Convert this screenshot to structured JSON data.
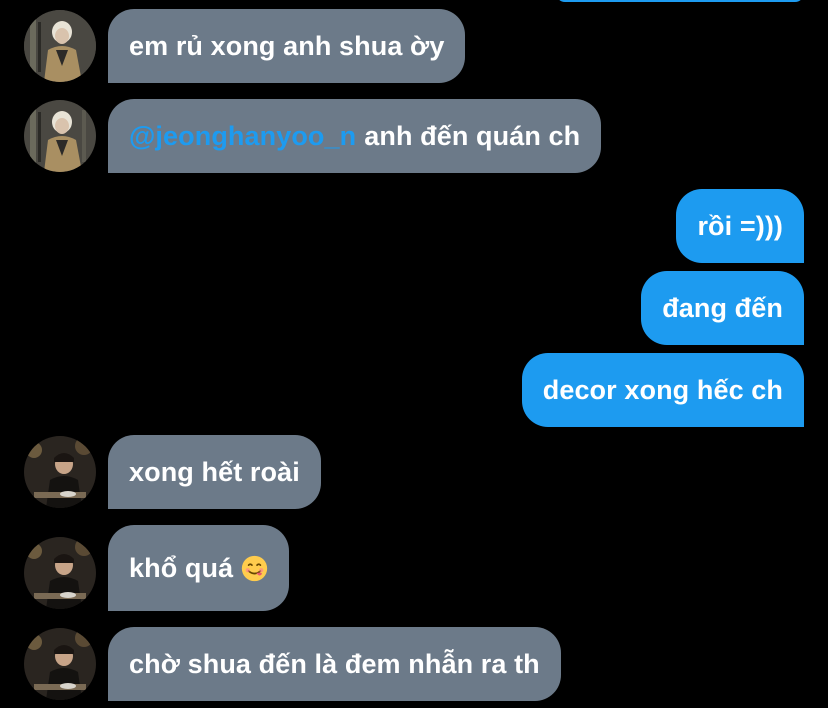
{
  "messages": [
    {
      "sender": "other",
      "avatar": "avatar-blond-man",
      "text": "em rủ xong anh shua ờy"
    },
    {
      "sender": "other",
      "avatar": "avatar-blond-man",
      "mention": "@jeonghanyoo_n",
      "text": "anh đến quán ch"
    },
    {
      "sender": "me",
      "text": "rồi =)))"
    },
    {
      "sender": "me",
      "text": "đang đến"
    },
    {
      "sender": "me",
      "text": "decor xong hếc ch"
    },
    {
      "sender": "other",
      "avatar": "avatar-dark-hair-man",
      "text": "xong hết roài"
    },
    {
      "sender": "other",
      "avatar": "avatar-dark-hair-man",
      "text": "khổ quá",
      "emoji": "face-savoring-food-emoji"
    },
    {
      "sender": "other",
      "avatar": "avatar-dark-hair-man",
      "text": "chờ shua đến là đem nhẫn ra th"
    }
  ],
  "colors": {
    "background": "#000000",
    "incoming_bubble": "#6c7a89",
    "outgoing_bubble": "#1d9bf0",
    "mention": "#1d9bf0",
    "text": "#ffffff"
  }
}
